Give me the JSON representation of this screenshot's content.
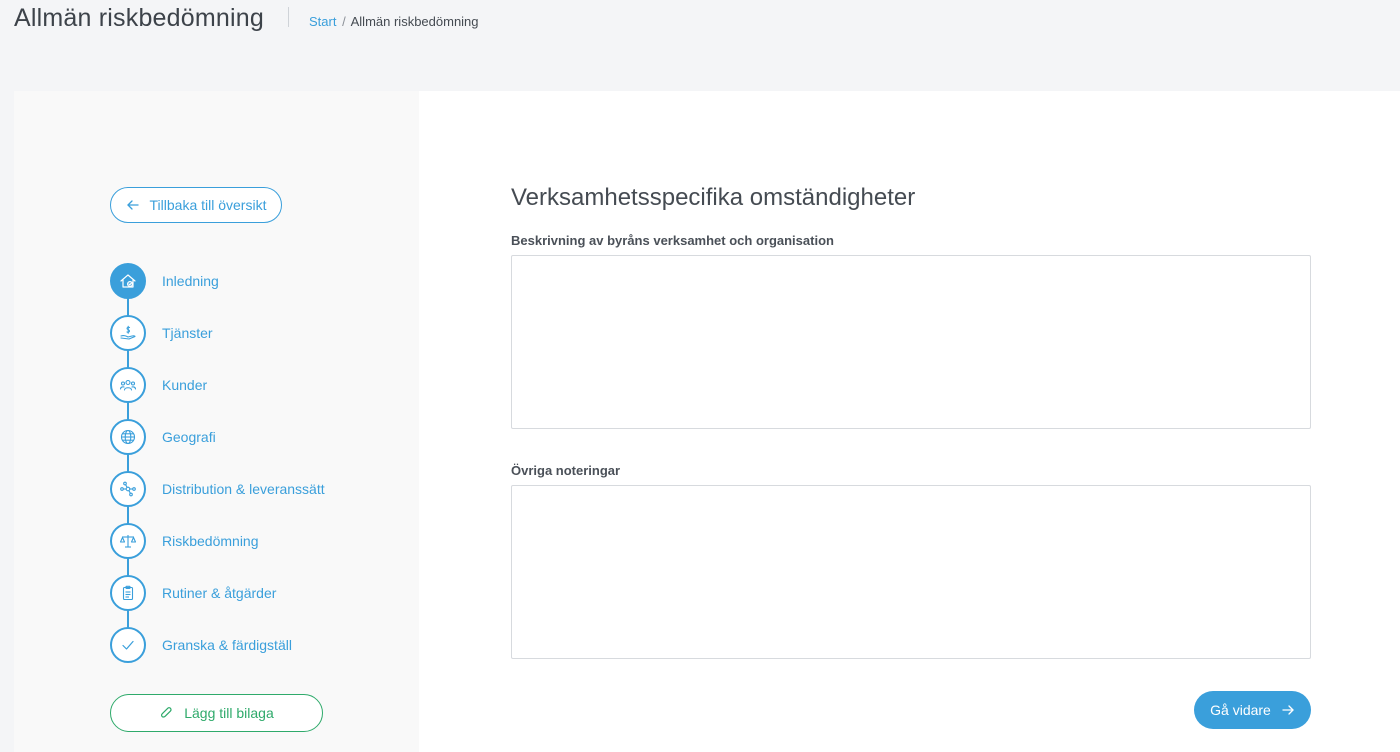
{
  "header": {
    "title": "Allmän riskbedömning",
    "breadcrumb": {
      "start": "Start",
      "separator": "/",
      "current": "Allmän riskbedömning"
    }
  },
  "sidebar": {
    "back_label": "Tillbaka till översikt",
    "steps": [
      {
        "label": "Inledning",
        "icon": "house-check-icon",
        "active": true
      },
      {
        "label": "Tjänster",
        "icon": "hand-dollar-icon",
        "active": false
      },
      {
        "label": "Kunder",
        "icon": "people-icon",
        "active": false
      },
      {
        "label": "Geografi",
        "icon": "globe-icon",
        "active": false
      },
      {
        "label": "Distribution & leveranssätt",
        "icon": "network-icon",
        "active": false
      },
      {
        "label": "Riskbedömning",
        "icon": "scale-icon",
        "active": false
      },
      {
        "label": "Rutiner & åtgärder",
        "icon": "clipboard-icon",
        "active": false
      },
      {
        "label": "Granska & färdigställ",
        "icon": "check-icon",
        "active": false
      }
    ],
    "attach_label": "Lägg till bilaga"
  },
  "main": {
    "section_title": "Verksamhetsspecifika omständigheter",
    "fields": [
      {
        "label": "Beskrivning av byråns verksamhet och organisation",
        "value": ""
      },
      {
        "label": "Övriga noteringar",
        "value": ""
      }
    ],
    "next_label": "Gå vidare"
  },
  "colors": {
    "accent": "#3a9fdb",
    "attach": "#2faa6b",
    "background": "#f4f5f7"
  }
}
